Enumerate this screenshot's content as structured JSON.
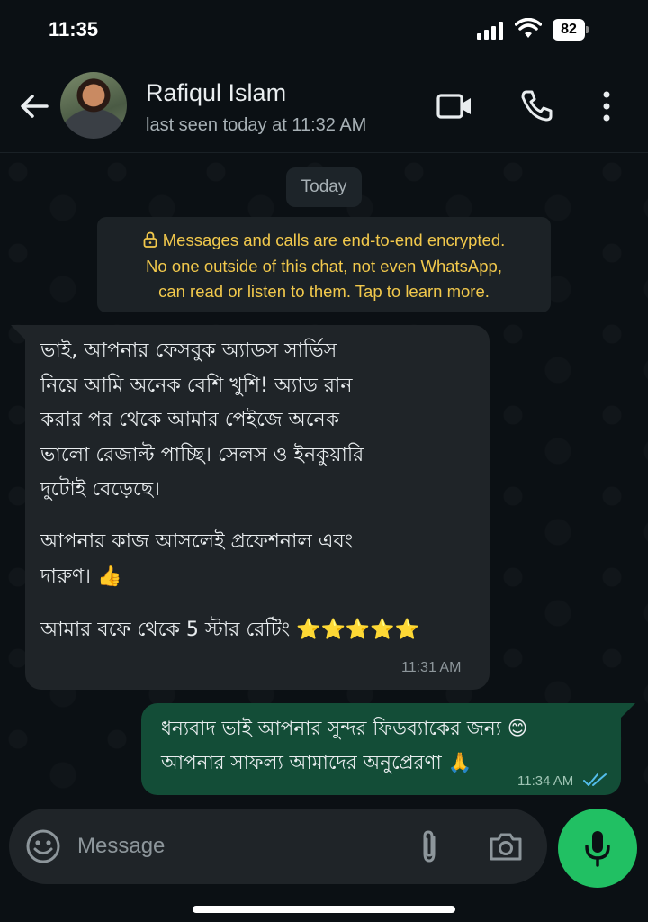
{
  "status_bar": {
    "time": "11:35",
    "battery": "82"
  },
  "header": {
    "contact_name": "Rafiqul Islam",
    "last_seen": "last seen today at 11:32 AM"
  },
  "chat": {
    "date_label": "Today",
    "encryption_notice": {
      "line1": "Messages and calls are end-to-end encrypted.",
      "line2": "No one outside of this chat, not even WhatsApp,",
      "line3": "can read or listen to them. Tap to learn more."
    },
    "messages": [
      {
        "direction": "incoming",
        "paragraph1": "ভাই, আপনার ফেসবুক অ্যাডস সার্ভিস\nনিয়ে আমি অনেক বেশি খুশি! অ্যাড রান\nকরার পর থেকে আমার পেইজে অনেক\nভালো রেজাল্ট পাচ্ছি। সেলস ও ইনকুয়ারি\nদুটোই বেড়েছে।",
        "paragraph2": "আপনার কাজ আসলেই প্রফেশনাল এবং\nদারুণ। 👍",
        "paragraph3": "আমার বফে থেকে 5 স্টার রেটিং ⭐⭐⭐⭐⭐",
        "time": "11:31 AM"
      },
      {
        "direction": "outgoing",
        "paragraph1": "ধন্যবাদ ভাই আপনার সুন্দর ফিডব্যাকের জন্য 😊\nআপনার সাফল্য আমাদের অনুপ্রেরণা 🙏",
        "time": "11:34 AM",
        "status": "read"
      }
    ]
  },
  "composer": {
    "placeholder": "Message"
  },
  "colors": {
    "background": "#0b1014",
    "incoming_bubble": "#1f2428",
    "outgoing_bubble": "#134d37",
    "accent_green": "#21c063",
    "notice_text": "#f2c94c",
    "read_ticks": "#53bdeb"
  },
  "icons": [
    "signal-icon",
    "wifi-icon",
    "battery-icon",
    "back-arrow-icon",
    "video-camera-icon",
    "phone-icon",
    "more-vertical-icon",
    "lock-icon",
    "double-check-icon",
    "emoji-icon",
    "paperclip-icon",
    "camera-icon",
    "microphone-icon"
  ]
}
